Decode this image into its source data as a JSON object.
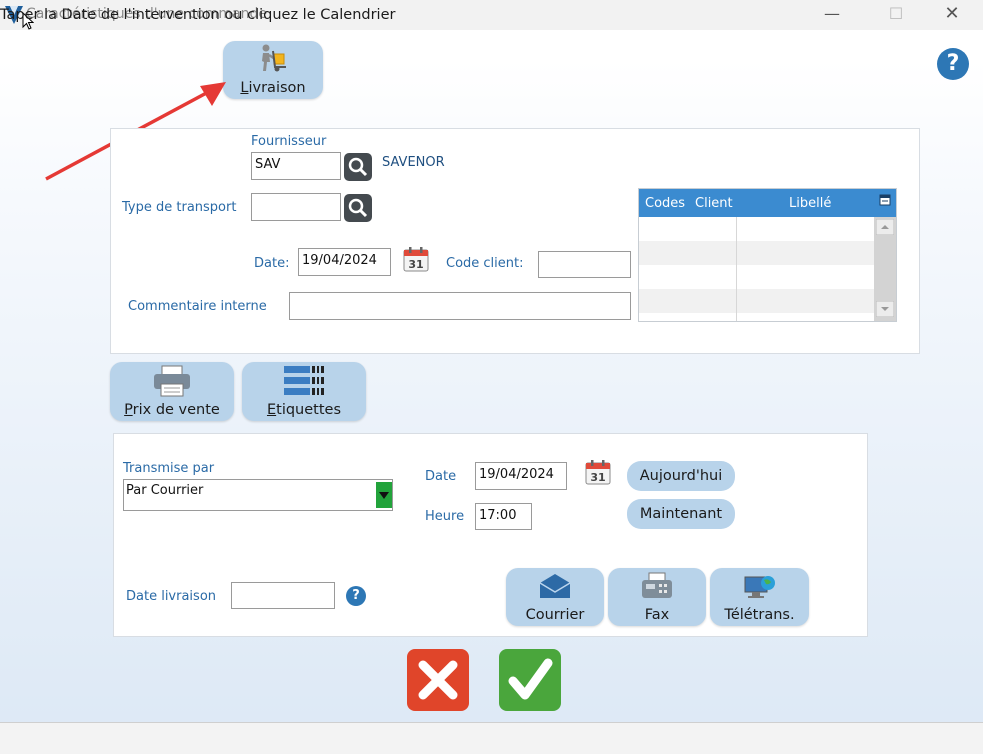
{
  "window": {
    "title": "Caractéristiques d'une commande",
    "minimize": "—",
    "maximize": "☐",
    "close": "✕"
  },
  "toolbar": {
    "livraison_label": "Livraison",
    "prix_vente_label": "Prix de vente",
    "etiquettes_label": "Etiquettes"
  },
  "order": {
    "fournisseur_label": "Fournisseur",
    "fournisseur_value": "SAV",
    "fournisseur_name": "SAVENOR",
    "type_transport_label": "Type de transport",
    "type_transport_value": "",
    "date_label": "Date:",
    "date_value": "19/04/2024",
    "code_client_label": "Code client:",
    "code_client_value": "",
    "commentaire_label": "Commentaire interne",
    "commentaire_value": "",
    "calendar_day": "31"
  },
  "grid": {
    "columns": [
      "Codes",
      "Client",
      "Libellé"
    ],
    "rows": []
  },
  "transmission": {
    "transmise_label": "Transmise par",
    "transmise_value": "Par Courrier",
    "date_label": "Date",
    "date_value": "19/04/2024",
    "heure_label": "Heure",
    "heure_value": "17:00",
    "aujourdhui_label": "Aujourd'hui",
    "maintenant_label": "Maintenant",
    "date_livraison_label": "Date livraison",
    "date_livraison_value": "",
    "courrier_label": "Courrier",
    "fax_label": "Fax",
    "teletrans_label": "Télétrans.",
    "calendar_day": "31"
  },
  "help_symbol": "?",
  "status": {
    "text": "Taper la Date de l'intervention ou cliquez le Calendrier"
  },
  "colors": {
    "accent_blue": "#2a6aa6",
    "button_blue": "#b8d3ea",
    "grid_header": "#3b8bd0",
    "cancel_red": "#e0452a",
    "ok_green": "#4aa63c",
    "arrow_red": "#e53935"
  },
  "icons": {
    "app": "v-logo-icon",
    "livraison": "delivery-man-icon",
    "search": "magnifier-icon",
    "calendar": "calendar-icon",
    "printer": "printer-icon",
    "labels": "barcode-icon",
    "mail": "envelope-icon",
    "fax": "fax-icon",
    "teletrans": "computer-globe-icon",
    "cancel": "x-icon",
    "ok": "check-icon"
  }
}
